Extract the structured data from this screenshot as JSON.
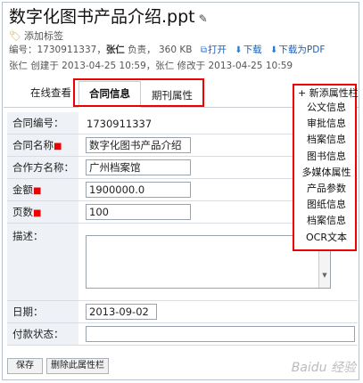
{
  "doc": {
    "title": "数字化图书产品介绍.ppt",
    "add_tag": "添加标签",
    "meta": {
      "number_label": "编号：",
      "number": "1730911337",
      "owner": "张仁",
      "owner_suffix": "负责",
      "size": "360 KB",
      "open": "打开",
      "download": "下载",
      "download_pdf": "下载为PDF",
      "created": "张仁 创建于 2013-04-25 10:59，张仁 修改于 2013-04-25 10:59"
    }
  },
  "tabs": {
    "online_view": "在线查看",
    "contract_info": "合同信息",
    "journal_attr": "期刊属性"
  },
  "form": {
    "contract_no": {
      "label": "合同编号：",
      "value": "1730911337"
    },
    "contract_name": {
      "label": "合同名称",
      "value": "数字化图书产品介绍"
    },
    "partner": {
      "label": "合作方名称：",
      "value": "广州档案馆"
    },
    "amount": {
      "label": "金额",
      "value": "1900000.0"
    },
    "pages": {
      "label": "页数",
      "value": "100"
    },
    "description": {
      "label": "描述：",
      "value": ""
    },
    "date": {
      "label": "日期：",
      "value": "2013-09-02"
    },
    "payment": {
      "label": "付款状态：",
      "value": ""
    }
  },
  "buttons": {
    "save": "保存",
    "delete_attr": "删除此属性栏"
  },
  "side_menu": {
    "header": "+ 新添属性栏",
    "items": [
      "公文信息",
      "审批信息",
      "档案信息",
      "图书信息",
      "多媒体属性",
      "产品参数",
      "图纸信息",
      "档案信息",
      "OCR文本"
    ]
  },
  "watermark": "Baidu 经验"
}
